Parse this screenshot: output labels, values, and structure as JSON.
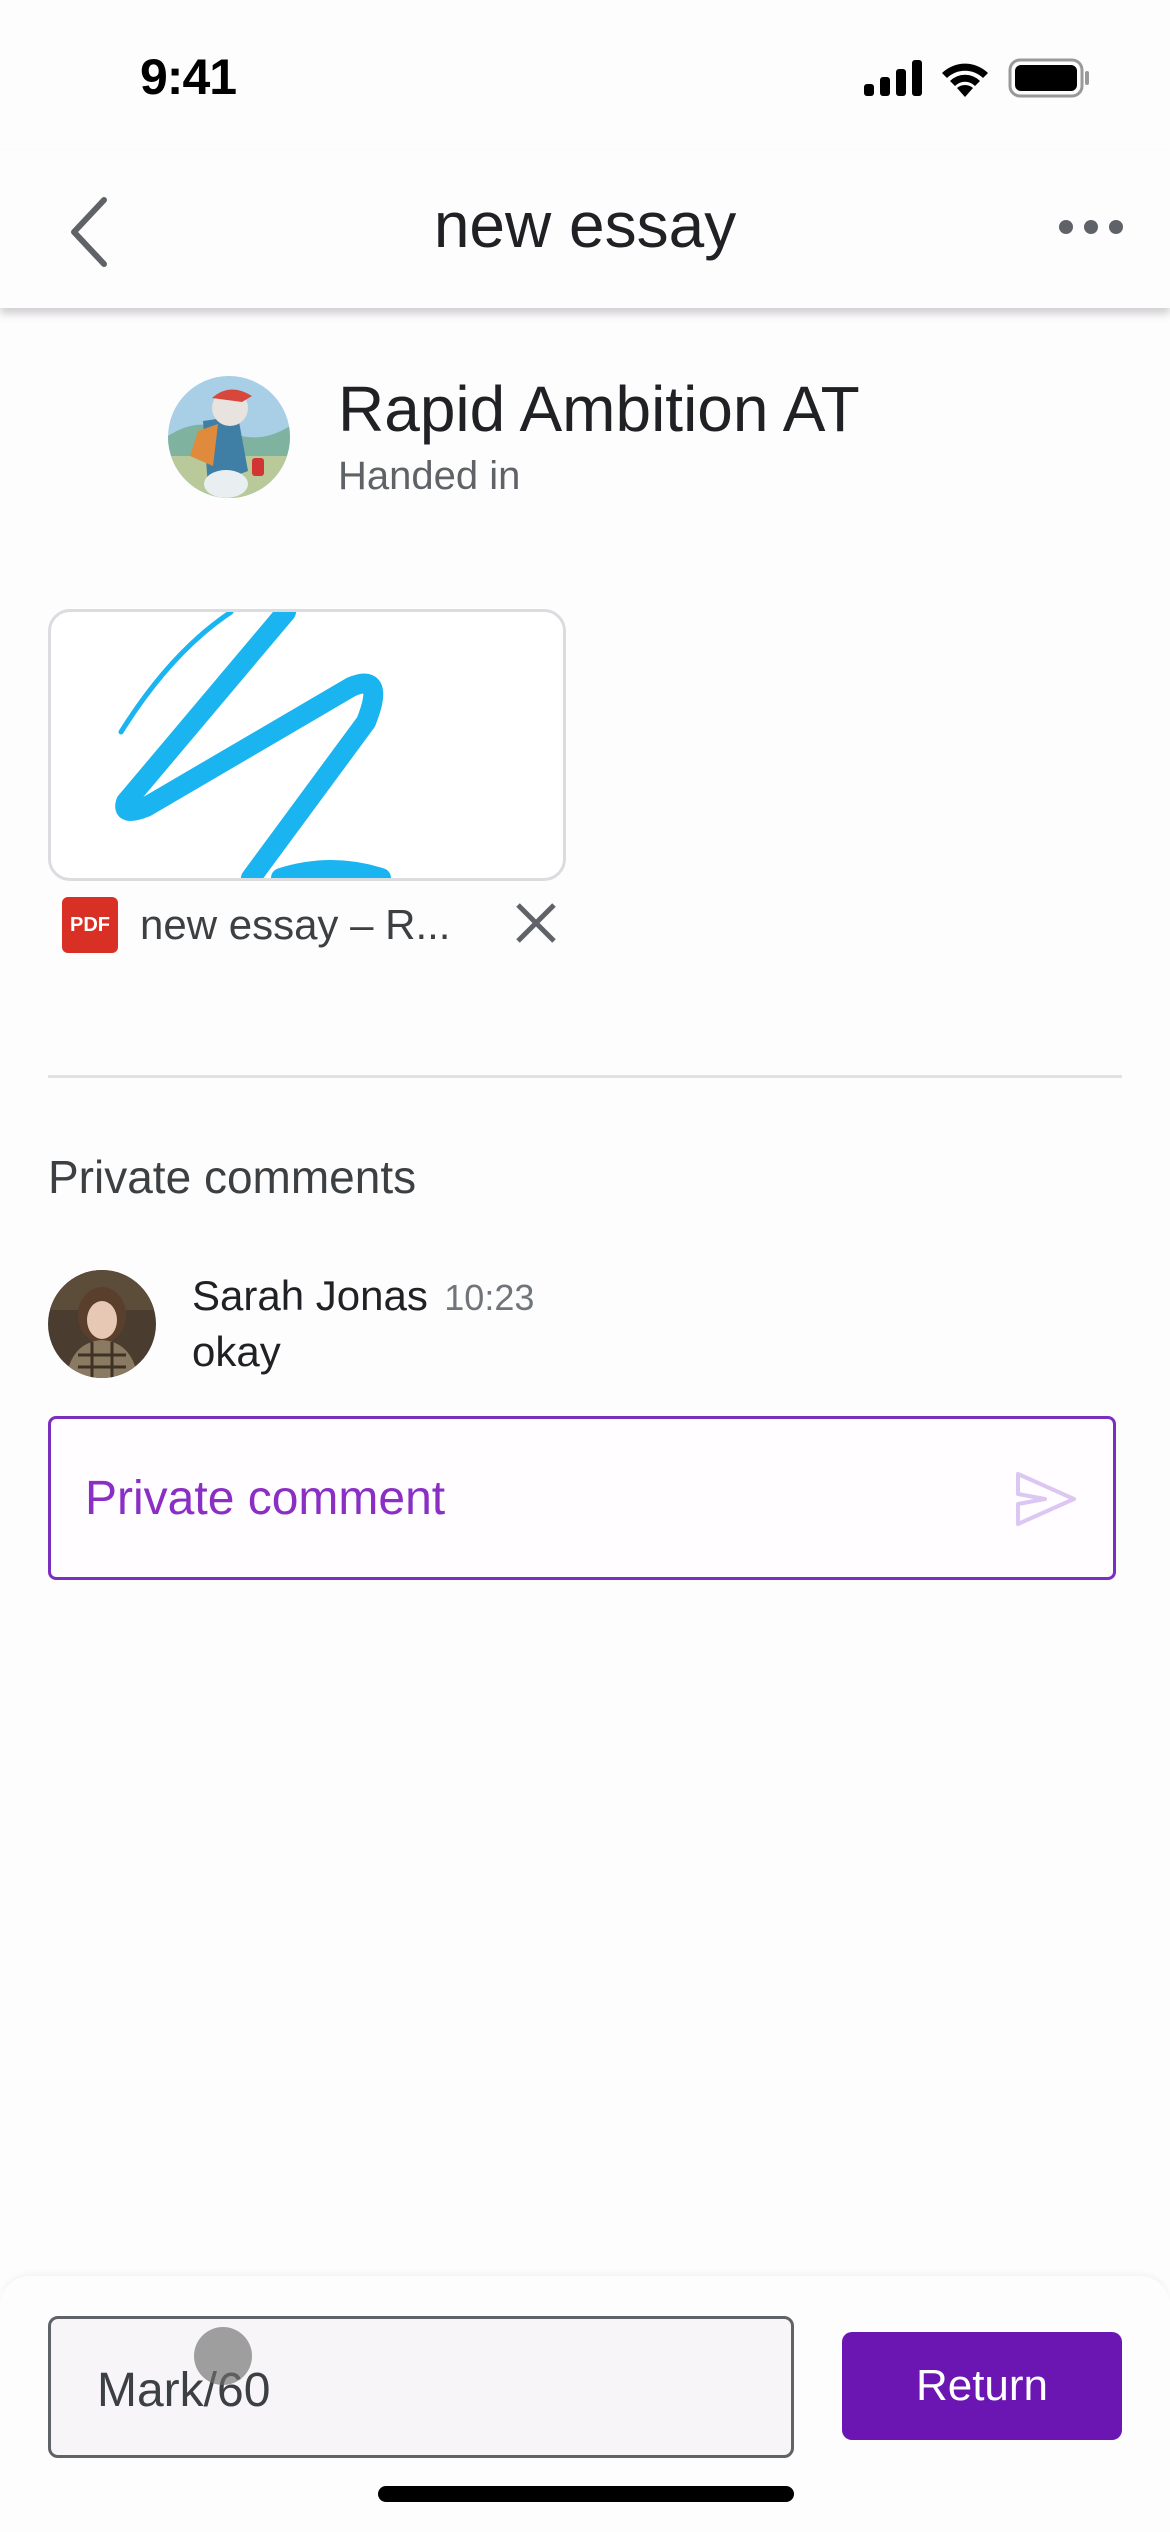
{
  "status_bar": {
    "time": "9:41"
  },
  "nav": {
    "title": "new essay",
    "back_icon": "chevron-left-icon",
    "more_icon": "more-horizontal-icon"
  },
  "student": {
    "name": "Rapid Ambition AT",
    "status": "Handed in"
  },
  "attachment": {
    "type_badge": "PDF",
    "name": "new essay – R...",
    "remove_icon": "close-icon"
  },
  "private_comments": {
    "title": "Private comments",
    "items": [
      {
        "author": "Sarah Jonas",
        "time": "10:23",
        "text": "okay"
      }
    ],
    "input_placeholder": "Private comment"
  },
  "grading": {
    "mark_placeholder": "Mark/60",
    "return_label": "Return"
  },
  "colors": {
    "accent": "#6b15b3",
    "input_accent": "#7b2fbf",
    "scribble": "#1ab4f0",
    "pdf": "#d93025"
  }
}
